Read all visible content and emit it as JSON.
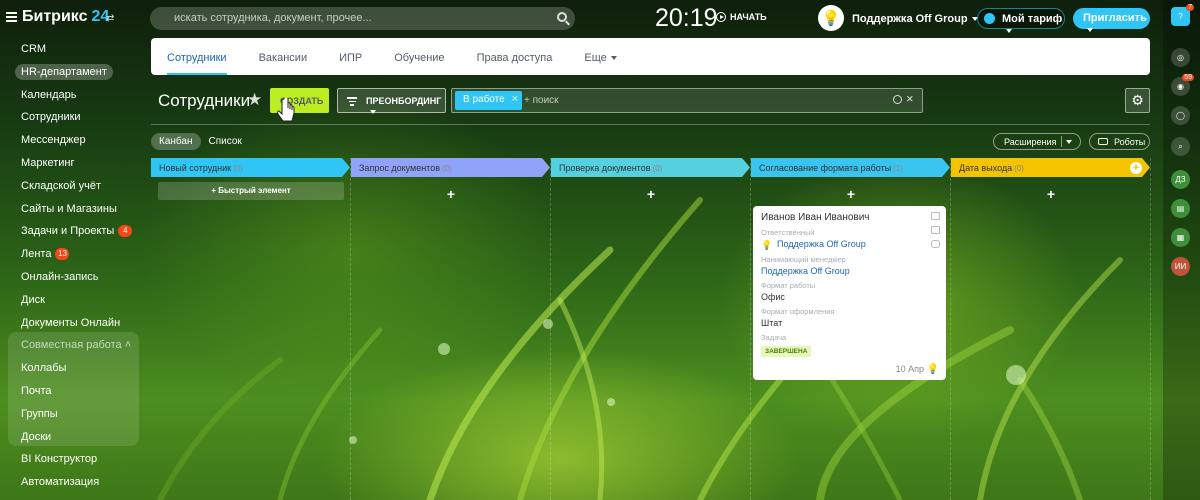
{
  "app": {
    "logo_text": "Битрикс",
    "logo_num": "24",
    "logo_switch": "⇄"
  },
  "search": {
    "placeholder": "искать сотрудника, документ, прочее..."
  },
  "clock": {
    "time": "20:19",
    "start_label": "НАЧАТЬ"
  },
  "user": {
    "name": "Поддержка Off Group",
    "avatar": "💡"
  },
  "tariff": {
    "label": "Мой тариф"
  },
  "invite": {
    "label": "Пригласить"
  },
  "menu": {
    "items": [
      {
        "label": "CRM"
      },
      {
        "label": "HR-департамент",
        "active": true
      },
      {
        "label": "Календарь"
      },
      {
        "label": "Сотрудники"
      },
      {
        "label": "Мессенджер"
      },
      {
        "label": "Маркетинг"
      },
      {
        "label": "Складской учёт"
      },
      {
        "label": "Сайты и Магазины"
      },
      {
        "label": "Задачи и Проекты",
        "badge": "4"
      },
      {
        "label": "Лента",
        "badge": "13"
      },
      {
        "label": "Онлайн-запись"
      },
      {
        "label": "Диск"
      },
      {
        "label": "Документы Онлайн"
      },
      {
        "label": "Совместная работа",
        "group": true
      },
      {
        "label": "Коллабы"
      },
      {
        "label": "Почта"
      },
      {
        "label": "Группы"
      },
      {
        "label": "Доски"
      },
      {
        "label": "BI Конструктор"
      },
      {
        "label": "Автоматизация"
      }
    ]
  },
  "rightbar": {
    "items": [
      {
        "icon": "help-icon",
        "glyph": "?",
        "badge": "7"
      },
      {
        "icon": "copilot-icon",
        "glyph": "◎"
      },
      {
        "icon": "chat-icon",
        "glyph": "◉",
        "badge": "59"
      },
      {
        "icon": "bell-icon",
        "glyph": "◯"
      },
      {
        "icon": "search-icon",
        "glyph": "⌕"
      },
      {
        "icon": "dz-icon",
        "glyph": "ДЗ"
      },
      {
        "icon": "doc-icon",
        "glyph": "▤"
      },
      {
        "icon": "sheet-icon",
        "glyph": "▦"
      },
      {
        "icon": "ii-icon",
        "glyph": "ИИ"
      }
    ]
  },
  "tabs": [
    "Сотрудники",
    "Вакансии",
    "ИПР",
    "Обучение",
    "Права доступа",
    "Еще"
  ],
  "toolbar": {
    "title": "Сотрудники",
    "create": "СОЗДАТЬ",
    "onboarding": "ПРЕОНБОРДИНГ",
    "filter_chip": "В работе",
    "filter_placeholder": "+ поиск"
  },
  "views": {
    "kanban": "Канбан",
    "list": "Список",
    "extensions": "Расширения",
    "robots": "Роботы"
  },
  "columns": [
    {
      "title": "Новый сотрудник",
      "count": "(0)",
      "color": "#2fc6f6",
      "quick": "+ Быстрый элемент"
    },
    {
      "title": "Запрос документов",
      "count": "(0)",
      "color": "#8fa3f8"
    },
    {
      "title": "Проверка документов",
      "count": "(0)",
      "color": "#55d0e0"
    },
    {
      "title": "Согласование формата работы",
      "count": "(1)",
      "color": "#39c5f0"
    },
    {
      "title": "Дата выхода",
      "count": "(0)",
      "color": "#f5c400"
    }
  ],
  "card": {
    "name": "Иванов Иван Иванович",
    "responsible_label": "Ответственный",
    "responsible": "Поддержка Off Group",
    "manager_label": "Нанимающий менеджер",
    "manager": "Поддержка Off Group",
    "format_label": "Формат работы",
    "format": "Офис",
    "employment_label": "Формат оформления",
    "employment": "Штат",
    "task_label": "Задача",
    "task_status": "ЗАВЕРШЕНА",
    "date": "10 Апр"
  }
}
